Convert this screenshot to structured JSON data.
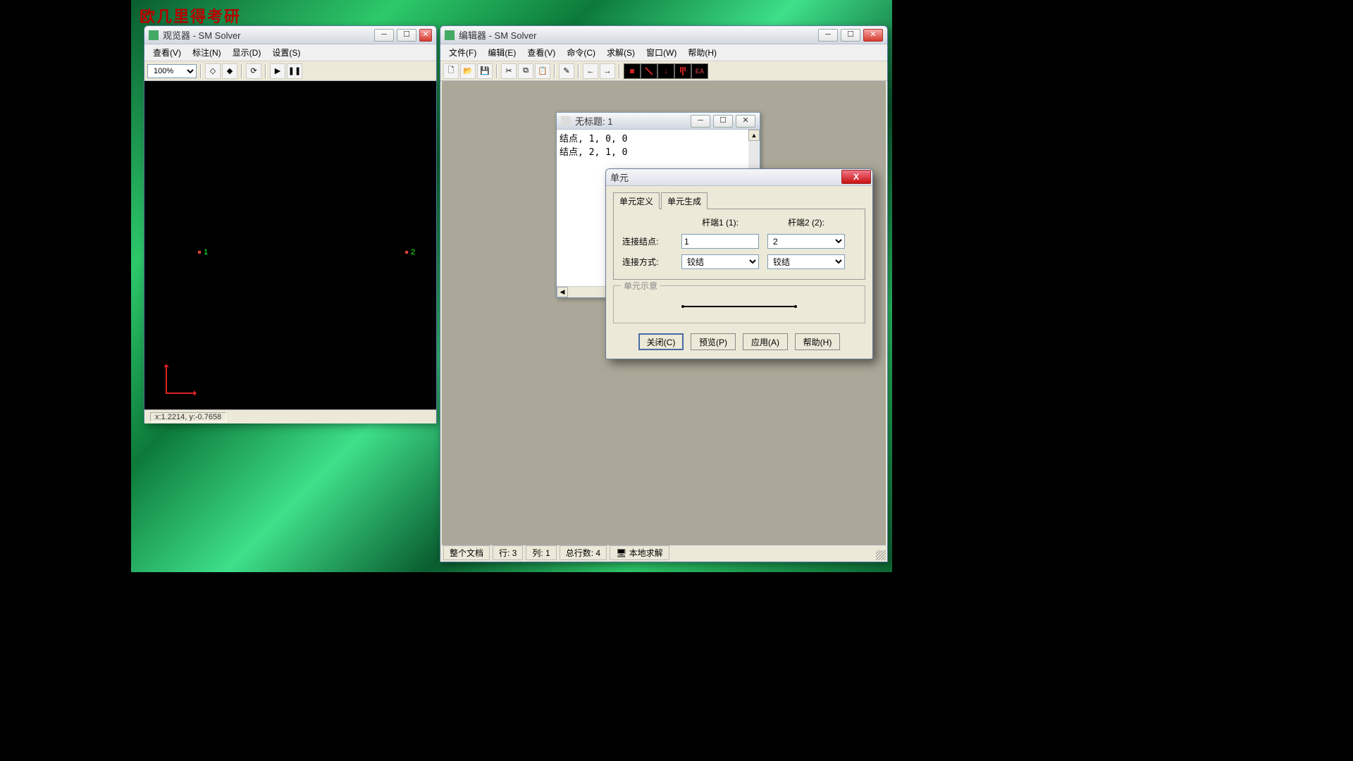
{
  "watermark": "欧几里得考研",
  "viewer": {
    "title": "观览器 - SM Solver",
    "menus": [
      "查看(V)",
      "标注(N)",
      "显示(D)",
      "设置(S)"
    ],
    "zoom": "100%",
    "nodes": {
      "n1": "1",
      "n2": "2"
    },
    "status": "x:1.2214, y:-0.7658"
  },
  "editor": {
    "title": "编辑器 - SM Solver",
    "menus": [
      "文件(F)",
      "编辑(E)",
      "查看(V)",
      "命令(C)",
      "求解(S)",
      "窗口(W)",
      "帮助(H)"
    ],
    "child": {
      "title": "无标题: 1",
      "text": "结点, 1, 0, 0\n结点, 2, 1, 0"
    },
    "status": {
      "scope": "整个文档",
      "row": "行: 3",
      "col": "列: 1",
      "total": "总行数: 4",
      "mode": "本地求解"
    }
  },
  "dialog": {
    "title": "单元",
    "tabs": [
      "单元定义",
      "单元生成"
    ],
    "headers": {
      "end1": "杆端1 (1):",
      "end2": "杆端2 (2):"
    },
    "labels": {
      "node": "连接结点:",
      "type": "连接方式:"
    },
    "values": {
      "node1": "1",
      "node2": "2",
      "type1": "铰结",
      "type2": "铰结"
    },
    "preview_legend": "单元示意",
    "buttons": {
      "close": "关闭(C)",
      "preview": "预览(P)",
      "apply": "应用(A)",
      "help": "帮助(H)"
    }
  }
}
